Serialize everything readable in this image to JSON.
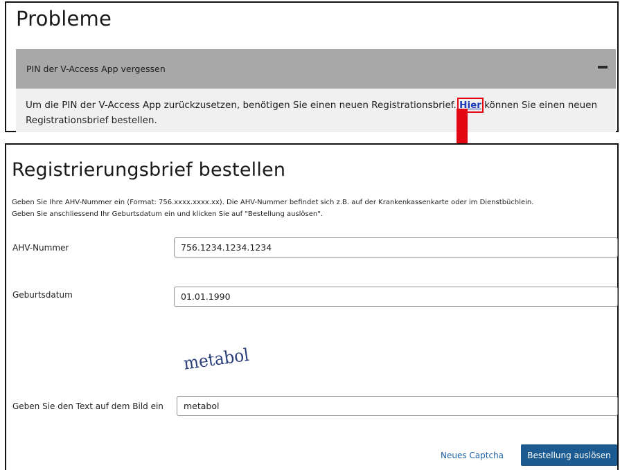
{
  "problems": {
    "heading": "Probleme",
    "accordion": {
      "title": "PIN der V-Access App vergessen",
      "toggle_icon": "minus-icon",
      "body_before": "Um die PIN der V-Access App zurückzusetzen, benötigen Sie einen neuen Registrationsbrief. ",
      "link_text": "Hier",
      "body_after": " können Sie einen neuen Registrationsbrief bestellen."
    }
  },
  "annotation": {
    "arrow_icon": "arrow-down-icon",
    "highlight_color": "#e30613"
  },
  "registration": {
    "heading": "Registrierungsbrief bestellen",
    "intro_line1": "Geben Sie Ihre AHV-Nummer ein (Format: 756.xxxx.xxxx.xx). Die AHV-Nummer befindet sich z.B. auf der Krankenkassenkarte oder im Dienstbüchlein.",
    "intro_line2": "Geben Sie anschliessend Ihr Geburtsdatum ein und klicken Sie auf \"Bestellung auslösen\".",
    "fields": {
      "ahv": {
        "label": "AHV-Nummer",
        "value": "756.1234.1234.1234"
      },
      "dob": {
        "label": "Geburtsdatum",
        "value": "01.01.1990"
      },
      "captcha": {
        "label": "Geben Sie den Text auf dem Bild ein",
        "value": "metabol",
        "image_text": "metabol"
      }
    },
    "new_captcha_label": "Neues Captcha",
    "submit_label": "Bestellung auslösen"
  },
  "colors": {
    "accordion_header": "#a8a8a8",
    "accordion_body": "#f0f0f0",
    "primary_button": "#1b5b91",
    "link": "#1b5fa3"
  }
}
